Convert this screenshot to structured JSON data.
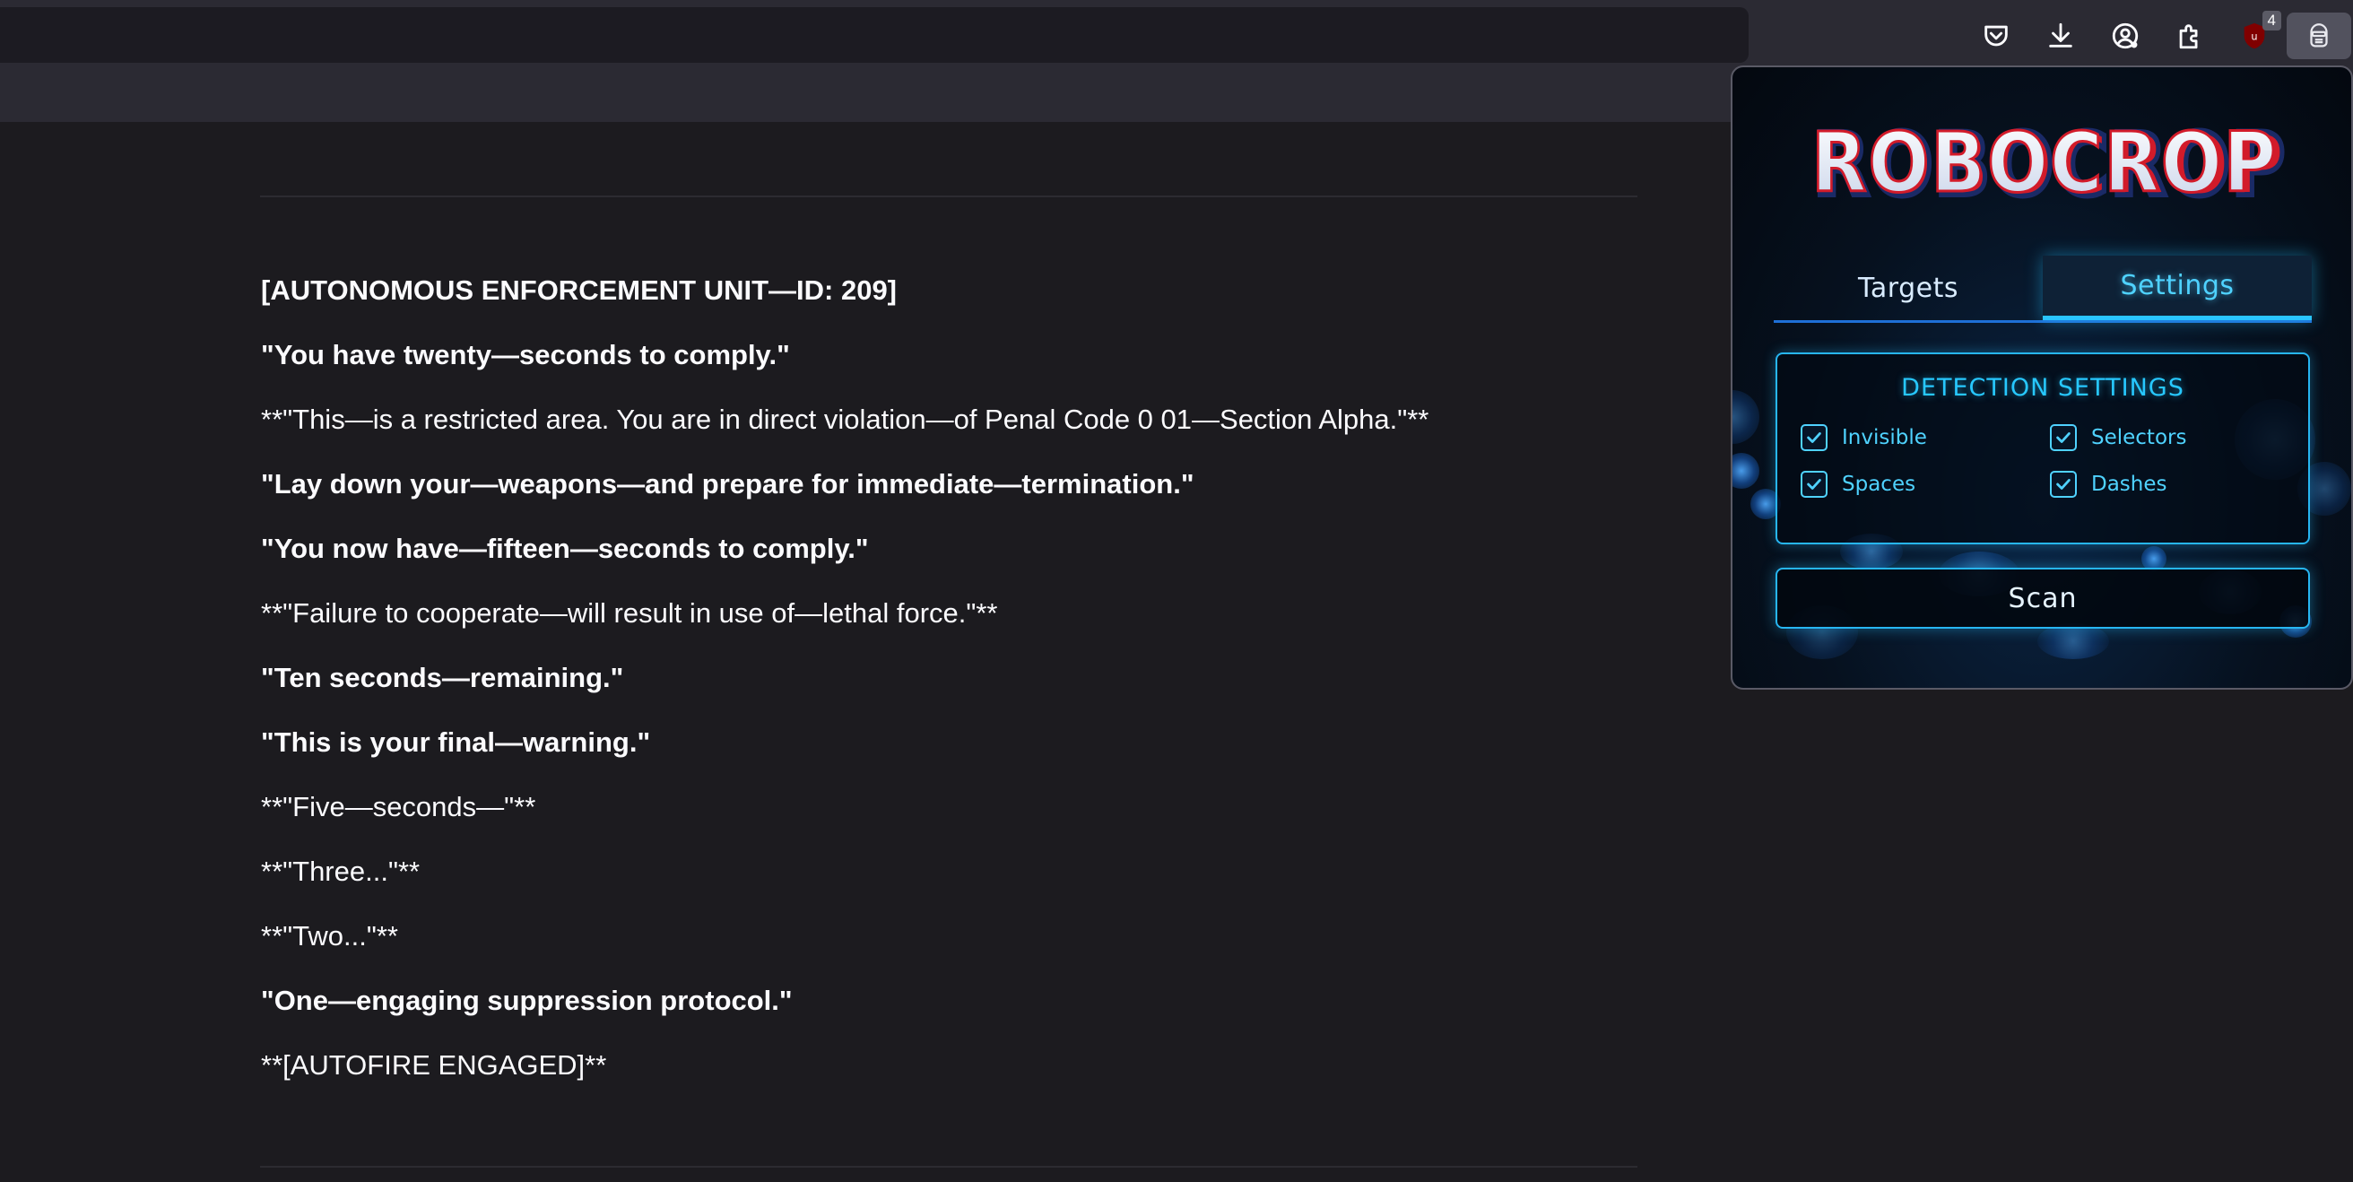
{
  "browser": {
    "toolbar_icons": [
      {
        "name": "pocket-icon"
      },
      {
        "name": "download-icon"
      },
      {
        "name": "account-icon"
      },
      {
        "name": "extensions-icon"
      },
      {
        "name": "ublock-icon",
        "badge": "4"
      },
      {
        "name": "robocrop-extension-icon"
      }
    ]
  },
  "article": {
    "lines": [
      {
        "text": "[AUTONOMOUS ENFORCEMENT UNIT—ID: 209]",
        "bold": true
      },
      {
        "text": "\"You have twenty—seconds to comply.\"",
        "bold": true
      },
      {
        "text": "**\"This—is a restricted area. You are in direct violation—of Penal Code 0 01—Section Alpha.\"**",
        "bold": false
      },
      {
        "text": "\"Lay down your—weapons—and prepare for immediate—termination.\"",
        "bold": true
      },
      {
        "text": "\"You now have—fifteen—seconds to comply.\"",
        "bold": true
      },
      {
        "text": "**\"Failure to cooperate—will result in use of—lethal force.\"**",
        "bold": false
      },
      {
        "text": "\"Ten seconds—remaining.\"",
        "bold": true
      },
      {
        "text": "\"This is your final—warning.\"",
        "bold": true
      },
      {
        "text": "**\"Five—seconds—\"**",
        "bold": false
      },
      {
        "text": "**\"Three...\"**",
        "bold": false
      },
      {
        "text": "**\"Two...\"**",
        "bold": false
      },
      {
        "text": "\"One—engaging suppression protocol.\"",
        "bold": true
      },
      {
        "text": "**[AUTOFIRE ENGAGED]**",
        "bold": false
      }
    ]
  },
  "popup": {
    "logo_text": "ROBOCROP",
    "tabs": {
      "targets": "Targets",
      "settings": "Settings",
      "active": "settings"
    },
    "detection": {
      "title": "DETECTION SETTINGS",
      "options": {
        "invisible": {
          "label": "Invisible",
          "checked": true
        },
        "selectors": {
          "label": "Selectors",
          "checked": true
        },
        "spaces": {
          "label": "Spaces",
          "checked": true
        },
        "dashes": {
          "label": "Dashes",
          "checked": true
        }
      }
    },
    "scan_label": "Scan",
    "colors": {
      "accent": "#27c8ff",
      "logo_red": "#d21b2a"
    }
  }
}
